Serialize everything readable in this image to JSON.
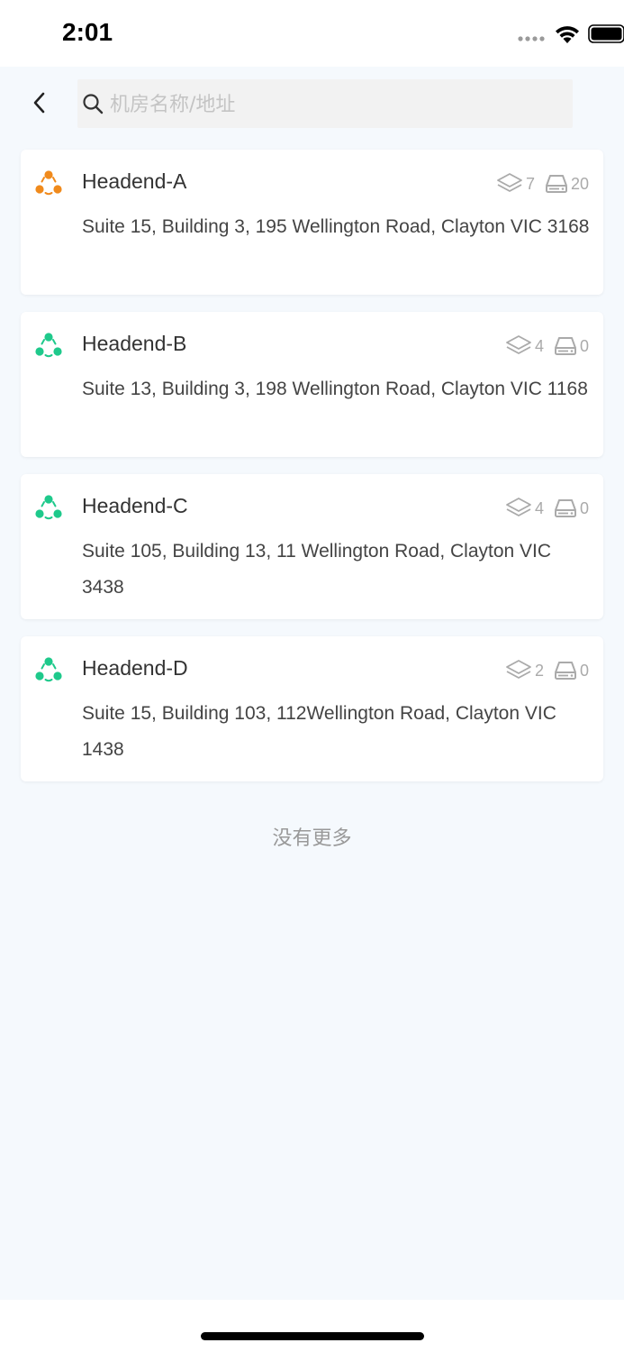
{
  "status_bar": {
    "time": "2:01",
    "icons": [
      "signal-dots-icon",
      "wifi-icon",
      "battery-icon"
    ]
  },
  "header": {
    "back_icon": "chevron-left-icon",
    "search": {
      "icon": "search-icon",
      "value": "",
      "placeholder": "机房名称/地址"
    }
  },
  "colors": {
    "accent_orange": "#f08a1c",
    "accent_green": "#1ec98b",
    "stat_gray": "#aaaaaa",
    "background": "#f5f9fd"
  },
  "headends": [
    {
      "name": "Headend-A",
      "address": "Suite 15, Building 3, 195 Wellington Road, Clayton VIC 3168",
      "status_color": "#f08a1c",
      "layers_count": "7",
      "devices_count": "20"
    },
    {
      "name": "Headend-B",
      "address": "Suite 13, Building 3, 198 Wellington Road, Clayton VIC 1168",
      "status_color": "#1ec98b",
      "layers_count": "4",
      "devices_count": "0"
    },
    {
      "name": "Headend-C",
      "address": "Suite 105, Building 13, 11 Wellington Road, Clayton VIC 3438",
      "status_color": "#1ec98b",
      "layers_count": "4",
      "devices_count": "0"
    },
    {
      "name": "Headend-D",
      "address": "Suite 15, Building 103, 112Wellington Road, Clayton VIC 1438",
      "status_color": "#1ec98b",
      "layers_count": "2",
      "devices_count": "0"
    }
  ],
  "footer": {
    "no_more": "没有更多"
  }
}
